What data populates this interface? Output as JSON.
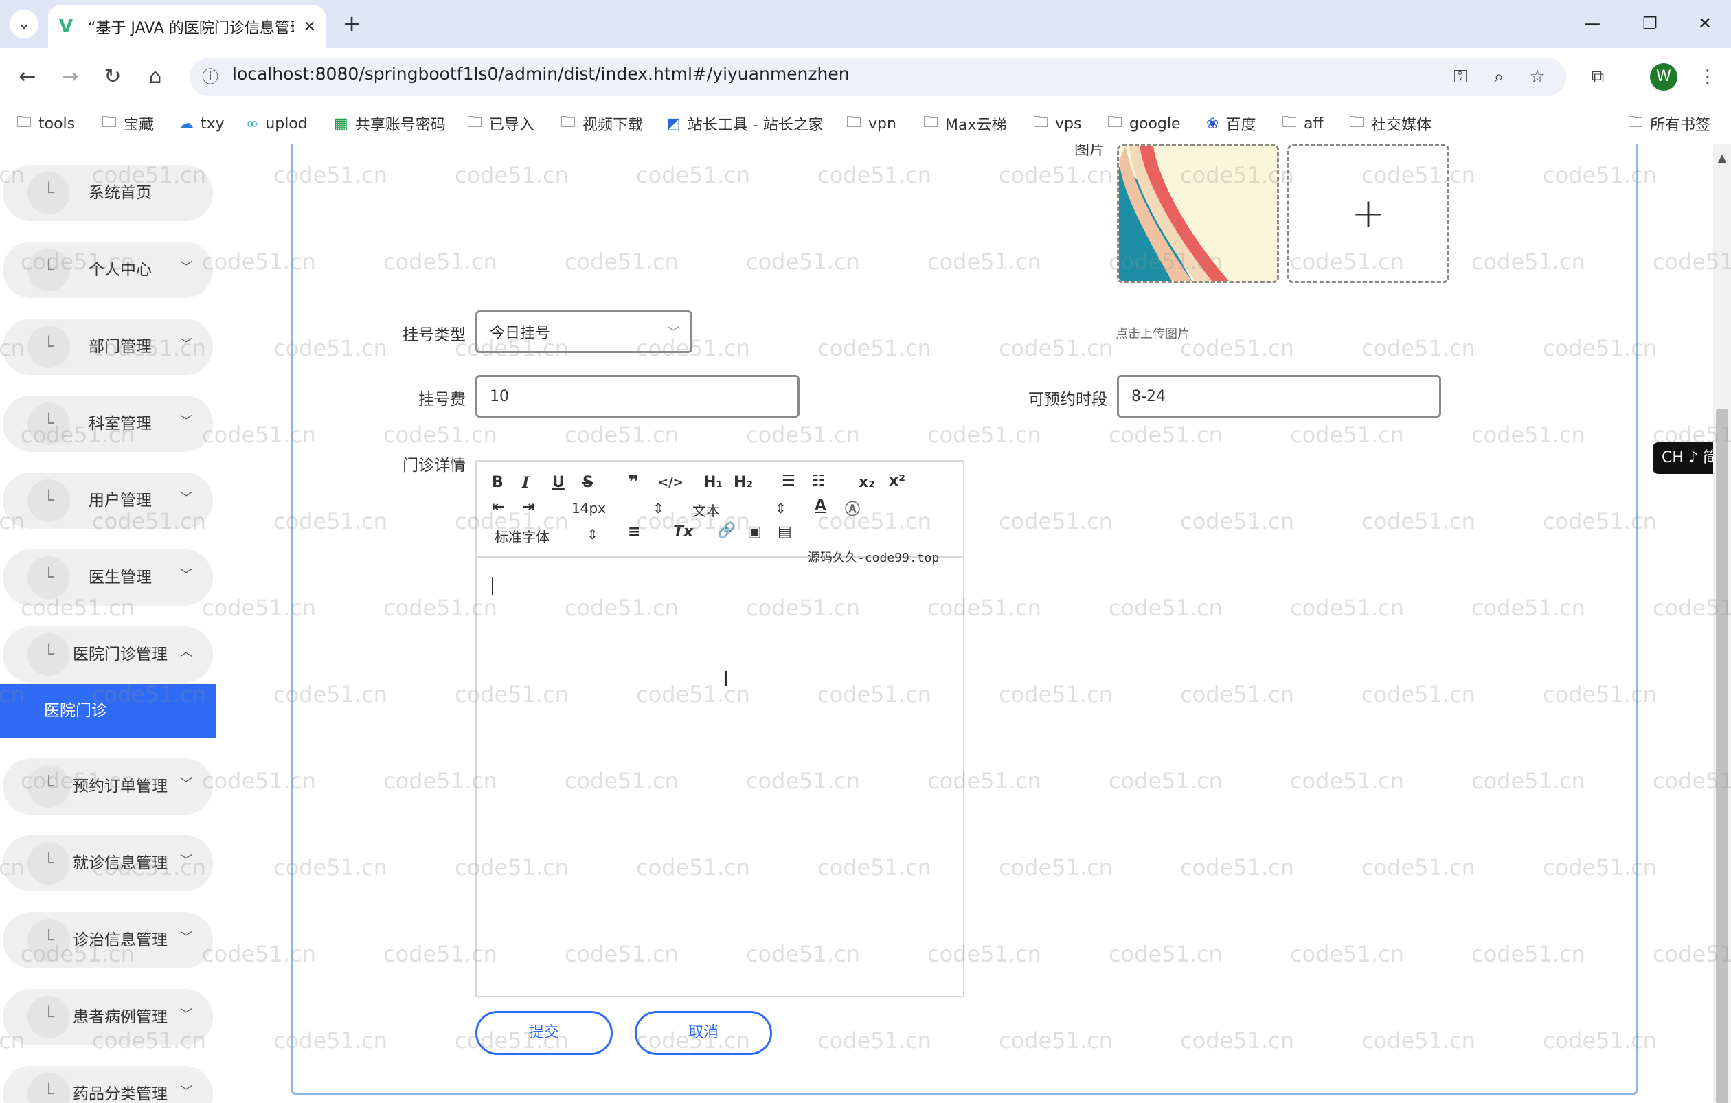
{
  "browser": {
    "tab_title": "“基于 JAVA 的医院门诊信息管理",
    "new_tab": "+",
    "url": "localhost:8080/springbootf1ls0/admin/dist/index.html#/yiyuanmenzhen",
    "profile_initial": "W",
    "bookmarks": [
      {
        "label": "tools",
        "icon": "folder-icon"
      },
      {
        "label": "宝藏",
        "icon": "folder-icon"
      },
      {
        "label": "txy",
        "icon": "cloud-icon"
      },
      {
        "label": "uplod",
        "icon": "link-icon"
      },
      {
        "label": "共享账号密码",
        "icon": "sheet-icon"
      },
      {
        "label": "已导入",
        "icon": "folder-icon"
      },
      {
        "label": "视频下载",
        "icon": "folder-icon"
      },
      {
        "label": "站长工具 - 站长之家",
        "icon": "site-icon"
      },
      {
        "label": "vpn",
        "icon": "folder-icon"
      },
      {
        "label": "Max云梯",
        "icon": "folder-icon"
      },
      {
        "label": "vps",
        "icon": "folder-icon"
      },
      {
        "label": "google",
        "icon": "folder-icon"
      },
      {
        "label": "百度",
        "icon": "paw-icon"
      },
      {
        "label": "aff",
        "icon": "folder-icon"
      },
      {
        "label": "社交媒体",
        "icon": "folder-icon"
      }
    ],
    "all_bookmarks": "所有书签"
  },
  "sidebar": {
    "items": [
      {
        "label": "系统首页",
        "has_chevron": false
      },
      {
        "label": "个人中心",
        "has_chevron": true
      },
      {
        "label": "部门管理",
        "has_chevron": true
      },
      {
        "label": "科室管理",
        "has_chevron": true
      },
      {
        "label": "用户管理",
        "has_chevron": true
      },
      {
        "label": "医生管理",
        "has_chevron": true
      },
      {
        "label": "医院门诊管理",
        "has_chevron": true,
        "expanded": true
      },
      {
        "label": "预约订单管理",
        "has_chevron": true
      },
      {
        "label": "就诊信息管理",
        "has_chevron": true
      },
      {
        "label": "诊治信息管理",
        "has_chevron": true
      },
      {
        "label": "患者病例管理",
        "has_chevron": true
      },
      {
        "label": "药品分类管理",
        "has_chevron": true
      }
    ],
    "active_subitem": "医院门诊"
  },
  "form": {
    "image_label": "图片",
    "upload_plus": "+",
    "upload_hint": "点击上传图片",
    "register_type": {
      "label": "挂号类型",
      "value": "今日挂号"
    },
    "fee": {
      "label": "挂号费",
      "value": "10"
    },
    "time_slot": {
      "label": "可预约时段",
      "value": "8-24"
    },
    "details": {
      "label": "门诊详情"
    },
    "editor": {
      "font_size": "14px",
      "heading": "文本",
      "font_family": "标准字体"
    },
    "watermark_note": "源码久久-code99.top",
    "submit": "提交",
    "cancel": "取消"
  },
  "ime": "CH ♪ 简",
  "watermark_text": "code51.cn",
  "colors": {
    "accent": "#2f6bf5",
    "tab_strip": "#dfe6f6"
  }
}
